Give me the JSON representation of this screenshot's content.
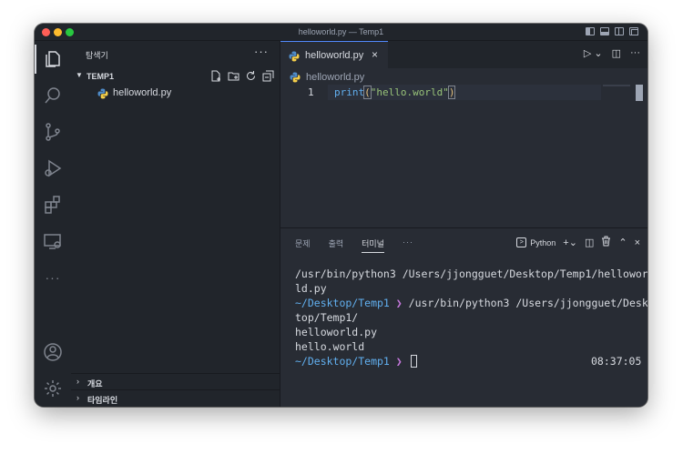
{
  "window": {
    "title": "helloworld.py — Temp1"
  },
  "sidebar": {
    "title": "탐색기",
    "folder": {
      "name": "TEMP1",
      "files": [
        {
          "name": "helloworld.py"
        }
      ]
    },
    "sections": [
      {
        "label": "개요"
      },
      {
        "label": "타임라인"
      }
    ]
  },
  "editor": {
    "tab": {
      "label": "helloworld.py"
    },
    "breadcrumb": "helloworld.py",
    "lines": [
      {
        "number": "1",
        "fn": "print",
        "open": "(",
        "str": "\"hello.world\"",
        "close": ")"
      }
    ]
  },
  "panel": {
    "tabs": [
      {
        "label": "문제"
      },
      {
        "label": "출력"
      },
      {
        "label": "터미널"
      }
    ],
    "active_tab": "터미널",
    "terminal_name": "Python",
    "terminal": {
      "line1": "/usr/bin/python3 /Users/jjongguet/Desktop/Temp1/hellowor",
      "line2": "ld.py",
      "prompt_path": "~/Desktop/Temp1",
      "prompt_arrow": "❯",
      "line3_cmd": " /usr/bin/python3 /Users/jjongguet/Desk",
      "line4": "top/Temp1/",
      "line5": "helloworld.py",
      "line6": "hello.world",
      "time": "08:37:05"
    }
  },
  "colors": {
    "accent": "#528bff",
    "prompt_path": "#61afef",
    "prompt_arrow": "#c678dd",
    "string": "#98c379",
    "function": "#61afef"
  }
}
